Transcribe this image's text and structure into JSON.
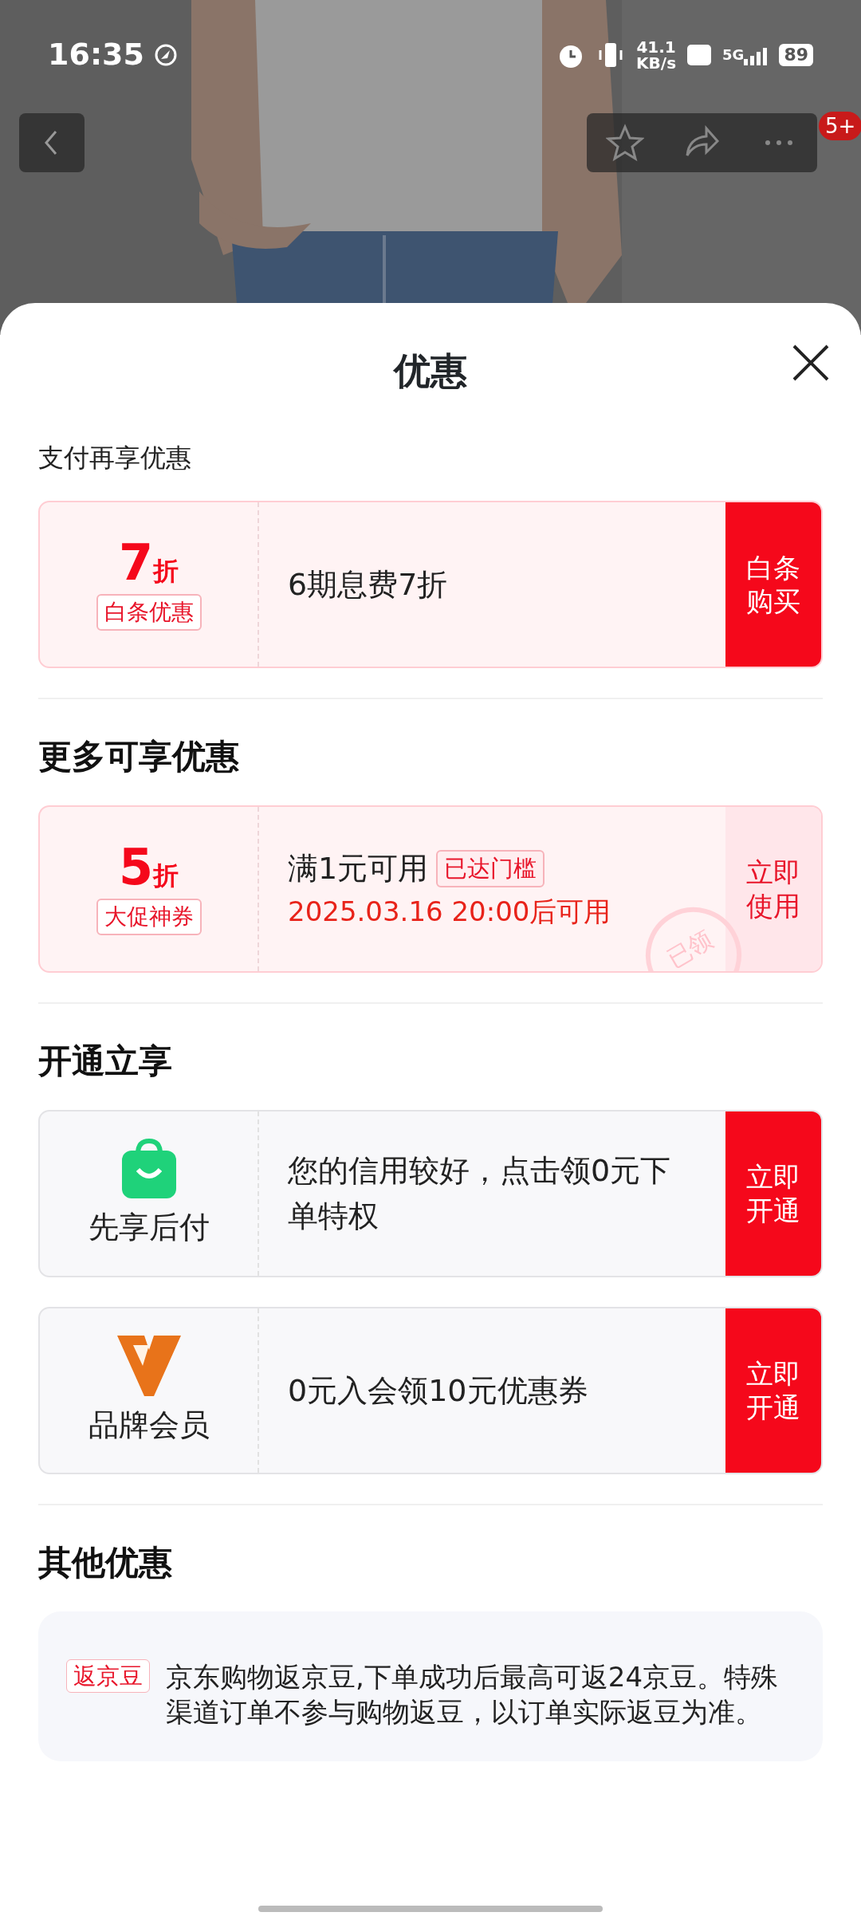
{
  "status_bar": {
    "time": "16:35",
    "speed": "41.1",
    "speed_unit": "KB/s",
    "network": "5G",
    "battery": "89"
  },
  "nav": {
    "badge": "5+"
  },
  "sheet": {
    "title": "优惠"
  },
  "sections": [
    {
      "title": "支付再享优惠",
      "cards": [
        {
          "kind": "discount",
          "value": "7",
          "unit": "折",
          "tag": "白条优惠",
          "text": "6期息费7折",
          "action": "白条购买"
        }
      ]
    },
    {
      "title": "更多可享优惠",
      "cards": [
        {
          "kind": "coupon",
          "value": "5",
          "unit": "折",
          "tag": "大促神券",
          "text": "满1元可用",
          "badge": "已达门槛",
          "date": "2025.03.16 20:00后可用",
          "action": "立即使用",
          "stamp": "已领"
        }
      ]
    },
    {
      "title": "开通立享",
      "cards": [
        {
          "kind": "service",
          "name": "先享后付",
          "text": "您的信用较好，点击领0元下单特权",
          "action": "立即开通"
        },
        {
          "kind": "service",
          "name": "品牌会员",
          "text": "0元入会领10元优惠券",
          "action": "立即开通"
        }
      ]
    },
    {
      "title": "其他优惠",
      "notes": [
        {
          "tag": "返京豆",
          "text": "京东购物返京豆,下单成功后最高可返24京豆。特殊渠道订单不参与购物返豆，以订单实际返豆为准。"
        }
      ]
    }
  ]
}
